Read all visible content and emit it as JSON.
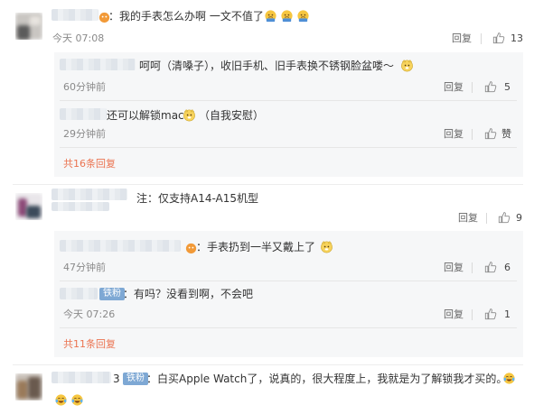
{
  "comment1": {
    "text": "：我的手表怎么办啊 一文不值了",
    "time": "今天 07:08",
    "reply_label": "回复",
    "like_count": "13"
  },
  "comment1_replies": [
    {
      "text": "呵呵（清嗓子），收旧手机、旧手表换不锈钢脸盆喽～",
      "time": "60分钟前",
      "reply_label": "回复",
      "like_count": "5"
    },
    {
      "text": "还可以解锁mac",
      "text_suffix": "（自我安慰）",
      "time": "29分钟前",
      "reply_label": "回复",
      "like_count": "赞"
    }
  ],
  "comment1_more": "共16条回复",
  "comment2": {
    "text": "注：仅支持A14-A15机型",
    "reply_label": "回复",
    "like_count": "9"
  },
  "comment2_replies": [
    {
      "text": "：手表扔到一半又戴上了",
      "time": "47分钟前",
      "reply_label": "回复",
      "like_count": "6"
    },
    {
      "badge": "铁粉",
      "text": "：有吗？没看到啊，不会吧",
      "time": "今天 07:26",
      "reply_label": "回复",
      "like_count": "1"
    }
  ],
  "comment2_more": "共11条回复",
  "comment3": {
    "name_tail": "3",
    "badge": "铁粉",
    "text": "：白买Apple Watch了，说真的，很大程度上，我就是为了解锁我才买的。"
  },
  "colors": {
    "accent_link": "#eb7350",
    "badge_bg": "#7ea8d4",
    "reply_box_bg": "#f6f7f8",
    "muted_text": "#8a8a8a"
  },
  "icons": [
    "thumb-up-icon",
    "avatar",
    "emoji-sweat",
    "emoji-cat-doge",
    "emoji-laugh-cry"
  ]
}
